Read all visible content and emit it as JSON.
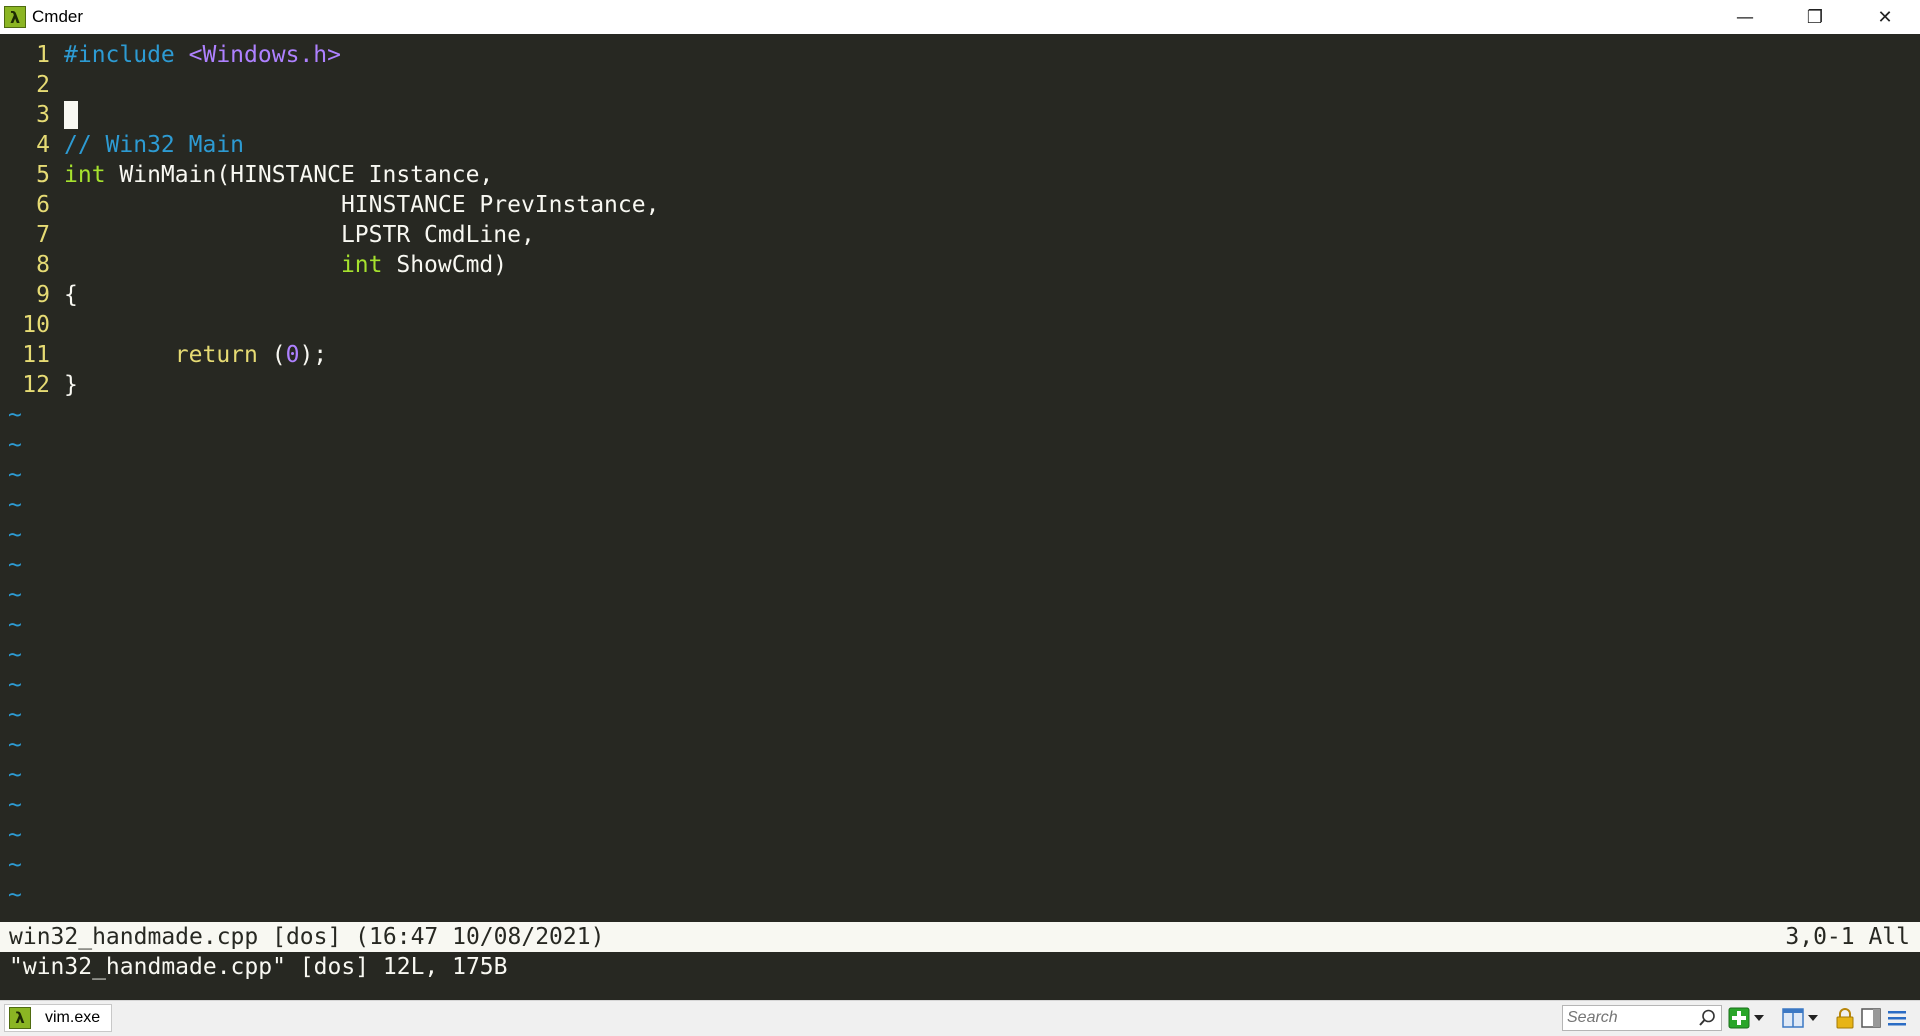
{
  "window": {
    "title": "Cmder",
    "logo_glyph": "λ",
    "controls": {
      "minimize": "—",
      "restore": "❐",
      "close": "✕"
    }
  },
  "editor": {
    "lines": [
      {
        "num": "1",
        "parts": [
          {
            "text": "#include",
            "color": "#2d9bd3"
          },
          {
            "text": " ",
            "color": "#f8f8f2"
          },
          {
            "text": "<Windows.h>",
            "color": "#ae81ff"
          }
        ]
      },
      {
        "num": "2",
        "parts": []
      },
      {
        "num": "3",
        "parts": [],
        "cursor": true
      },
      {
        "num": "4",
        "parts": [
          {
            "text": "// Win32 Main",
            "color": "#2d9bd3"
          }
        ]
      },
      {
        "num": "5",
        "parts": [
          {
            "text": "int",
            "color": "#a6e22e"
          },
          {
            "text": " WinMain(HINSTANCE Instance,",
            "color": "#f8f8f2"
          }
        ]
      },
      {
        "num": "6",
        "parts": [
          {
            "text": "                    HINSTANCE PrevInstance,",
            "color": "#f8f8f2"
          }
        ]
      },
      {
        "num": "7",
        "parts": [
          {
            "text": "                    LPSTR CmdLine,",
            "color": "#f8f8f2"
          }
        ]
      },
      {
        "num": "8",
        "parts": [
          {
            "text": "                    ",
            "color": "#f8f8f2"
          },
          {
            "text": "int",
            "color": "#a6e22e"
          },
          {
            "text": " ShowCmd)",
            "color": "#f8f8f2"
          }
        ]
      },
      {
        "num": "9",
        "parts": [
          {
            "text": "{",
            "color": "#f8f8f2"
          }
        ]
      },
      {
        "num": "10",
        "parts": []
      },
      {
        "num": "11",
        "parts": [
          {
            "text": "        ",
            "color": "#f8f8f2"
          },
          {
            "text": "return",
            "color": "#e6db74"
          },
          {
            "text": " (",
            "color": "#f8f8f2"
          },
          {
            "text": "0",
            "color": "#ae81ff"
          },
          {
            "text": ");",
            "color": "#f8f8f2"
          }
        ]
      },
      {
        "num": "12",
        "parts": [
          {
            "text": "}",
            "color": "#f8f8f2"
          }
        ]
      }
    ],
    "tilde_glyph": "~",
    "tilde_count": 17
  },
  "statusline": {
    "left": "win32_handmade.cpp [dos] (16:47 10/08/2021)",
    "right": "3,0-1 All"
  },
  "message": "\"win32_handmade.cpp\" [dos] 12L, 175B",
  "tabbar": {
    "tab_label": "vim.exe",
    "tab_glyph": "λ",
    "search_placeholder": "Search"
  },
  "colors": {
    "background": "#272822",
    "foreground": "#f8f8f2",
    "line_number": "#e6db74",
    "tilde": "#2d9bd3",
    "accent_green": "#8bb523"
  }
}
